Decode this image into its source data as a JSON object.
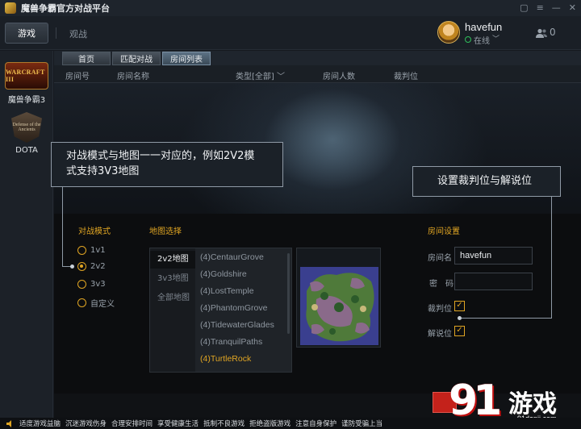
{
  "app": {
    "title": "魔兽争霸官方对战平台"
  },
  "topnav": {
    "tab_game": "游戏",
    "tab_watch": "观战"
  },
  "user": {
    "name": "havefun",
    "status": "在线",
    "friends_count": "0"
  },
  "sidebar": {
    "items": [
      {
        "label": "魔兽争霸3",
        "logo_text": "WARCRAFT III"
      },
      {
        "label": "DOTA",
        "logo_text": "Defense of the Ancients"
      }
    ]
  },
  "subtabs": [
    {
      "label": "首页",
      "active": false
    },
    {
      "label": "匹配对战",
      "active": false
    },
    {
      "label": "房间列表",
      "active": true
    }
  ],
  "columns": {
    "room_no": "房间号",
    "room_name": "房间名称",
    "type": "类型[全部]",
    "players": "房间人数",
    "referee": "裁判位"
  },
  "callouts": {
    "mode_map": {
      "line1": "对战模式与地图一一对应的，例如2V2模",
      "line2": "式支持3V3地图"
    },
    "referee": "设置裁判位与解说位"
  },
  "dialog": {
    "mode_title": "对战模式",
    "modes": [
      {
        "label": "1v1",
        "selected": false
      },
      {
        "label": "2v2",
        "selected": true
      },
      {
        "label": "3v3",
        "selected": false
      },
      {
        "label": "自定义",
        "selected": false
      }
    ],
    "map_title": "地图选择",
    "map_tabs": [
      {
        "label": "2v2地图",
        "active": true
      },
      {
        "label": "3v3地图",
        "active": false
      },
      {
        "label": "全部地图",
        "active": false
      }
    ],
    "maps": [
      {
        "label": "(4)CentaurGrove",
        "selected": false
      },
      {
        "label": "(4)Goldshire",
        "selected": false
      },
      {
        "label": "(4)LostTemple",
        "selected": false
      },
      {
        "label": "(4)PhantomGrove",
        "selected": false
      },
      {
        "label": "(4)TidewaterGlades",
        "selected": false
      },
      {
        "label": "(4)TranquilPaths",
        "selected": false
      },
      {
        "label": "(4)TurtleRock",
        "selected": true
      }
    ],
    "room_title": "房间设置",
    "room_name_label": "房间名",
    "room_name_value": "havefun",
    "password_label": "密　码",
    "password_value": "",
    "referee_label": "裁判位",
    "referee_checked": true,
    "commentator_label": "解说位",
    "commentator_checked": true
  },
  "watermark": {
    "number": "91",
    "word": "游戏",
    "url": "91danji.com"
  },
  "statusbar": {
    "items": [
      "适度游戏益脑",
      "沉迷游戏伤身",
      "合理安排时间",
      "享受健康生活",
      "抵制不良游戏",
      "拒绝盗版游戏",
      "注意自身保护",
      "谨防受骗上当"
    ]
  },
  "colors": {
    "accent": "#e0a523",
    "online": "#2fbf5a",
    "danger": "#c4221b"
  }
}
